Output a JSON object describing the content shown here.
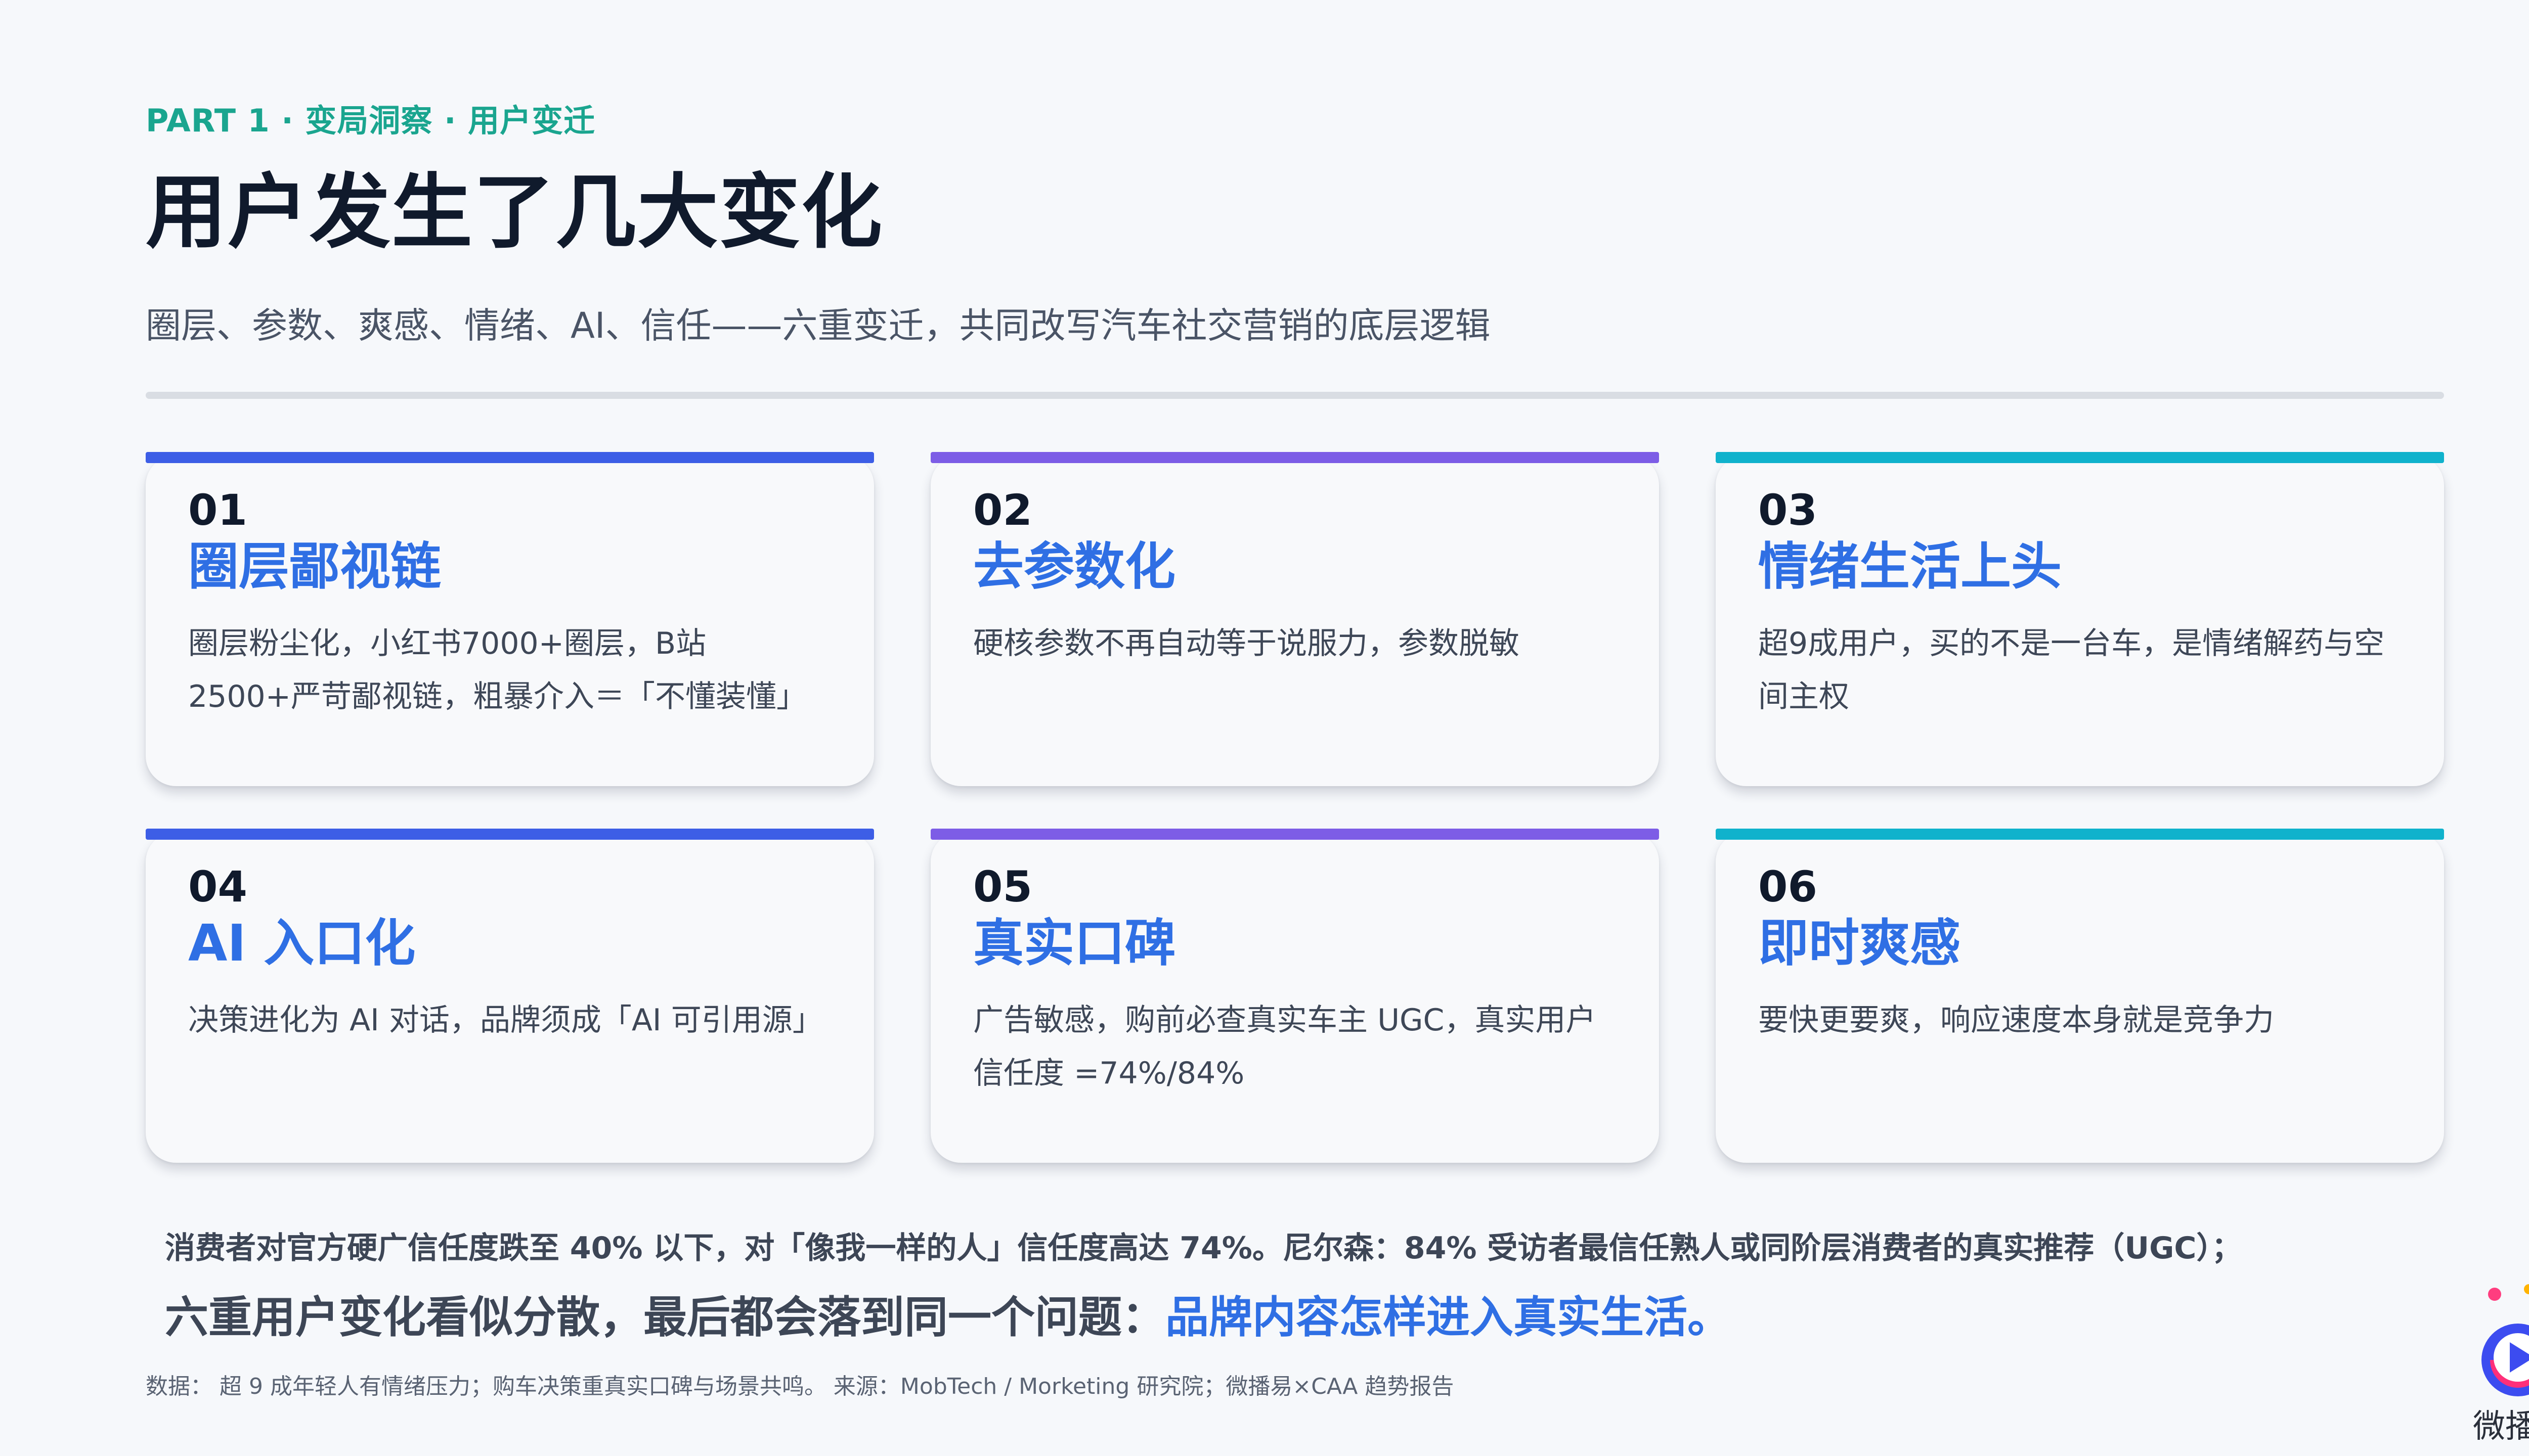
{
  "header": {
    "kicker": "PART 1 · 变局洞察 · 用户变迁",
    "title": "用户发生了几大变化",
    "subtitle": "圈层、参数、爽感、情绪、AI、信任——六重变迁，共同改写汽车社交营销的底层逻辑"
  },
  "colors": {
    "blue": "#3d5ee6",
    "purple": "#7d5de6",
    "teal": "#10b2cc",
    "accent_text": "#2f6fe4",
    "kicker": "#1aa58f"
  },
  "cards": [
    {
      "num": "01",
      "title": "圈层鄙视链",
      "desc": "圈层粉尘化，小红书7000+圈层，B站2500+严苛鄙视链，粗暴介入＝「不懂装懂」",
      "bar_color": "#3d5ee6"
    },
    {
      "num": "02",
      "title": "去参数化",
      "desc": "硬核参数不再自动等于说服力，参数脱敏",
      "bar_color": "#7d5de6"
    },
    {
      "num": "03",
      "title": "情绪生活上头",
      "desc": "超9成用户，买的不是一台车，是情绪解药与空间主权",
      "bar_color": "#10b2cc"
    },
    {
      "num": "04",
      "title": "AI 入口化",
      "desc": "决策进化为 AI 对话，品牌须成「AI 可引用源」",
      "bar_color": "#3d5ee6"
    },
    {
      "num": "05",
      "title": "真实口碑",
      "desc": "广告敏感，购前必查真实车主 UGC，真实用户信任度 =74%/84%",
      "bar_color": "#7d5de6"
    },
    {
      "num": "06",
      "title": "即时爽感",
      "desc": "要快更要爽，响应速度本身就是竞争力",
      "bar_color": "#10b2cc"
    }
  ],
  "footer": {
    "note1": "消费者对官方硬广信任度跌至 40% 以下，对「像我一样的人」信任度高达 74%。尼尔森：84% 受访者最信任熟人或同阶层消费者的真实推荐（UGC）；",
    "note2_prefix": "六重用户变化看似分散，最后都会落到同一个问题：",
    "note2_highlight": "品牌内容怎样进入真实生活。",
    "source": "数据：  超 9 成年轻人有情绪压力；购车决策重真实口碑与场景共鸣。  来源：MobTech / Morketing 研究院；微播易×CAA 趋势报告"
  },
  "brand": {
    "name": "微播易",
    "logo_icon": "play-logo-icon"
  }
}
